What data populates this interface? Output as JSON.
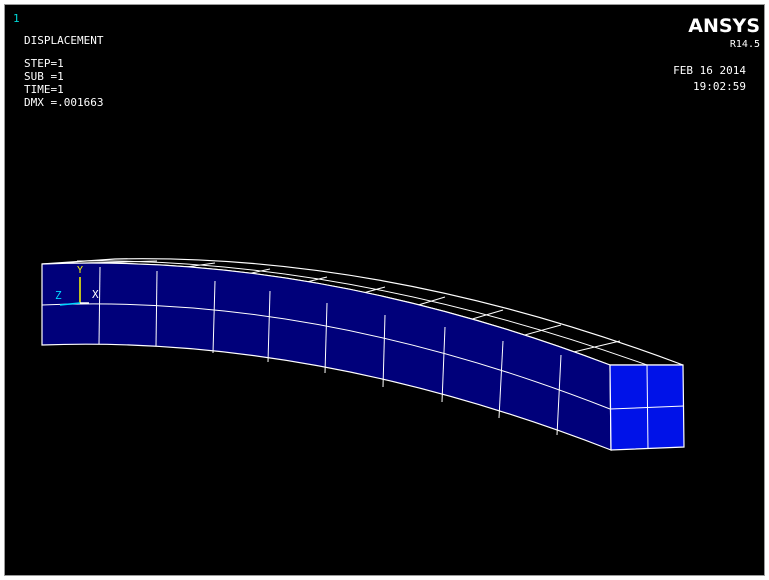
{
  "window": {
    "number": "1"
  },
  "result": {
    "type": "DISPLACEMENT",
    "step": "STEP=1",
    "sub": "SUB =1",
    "time": "TIME=1",
    "dmx": "DMX =.001663"
  },
  "brand": {
    "logo": "ANSYS",
    "version": "R14.5"
  },
  "timestamp": {
    "date": "FEB 16 2014",
    "time": "19:02:59"
  },
  "triad": {
    "y_label": "Y",
    "z_label": "Z",
    "x_label": "X"
  },
  "colors": {
    "background": "#000000",
    "element_fill": "#00007a",
    "element_end_fill": "#0012e8",
    "edge": "#ffffff",
    "triad_y": "#ffff00",
    "triad_z": "#00d7ff",
    "triad_x": "#ffffff"
  }
}
